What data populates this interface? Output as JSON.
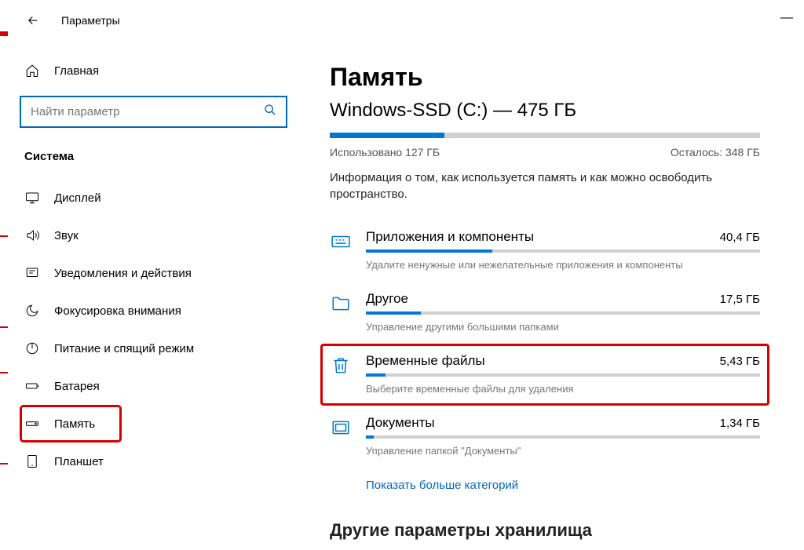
{
  "header": {
    "title": "Параметры"
  },
  "sidebar": {
    "home_label": "Главная",
    "search_placeholder": "Найти параметр",
    "section_label": "Система",
    "items": [
      {
        "label": "Дисплей",
        "icon": "display",
        "highlighted": false
      },
      {
        "label": "Звук",
        "icon": "sound",
        "highlighted": false
      },
      {
        "label": "Уведомления и действия",
        "icon": "notifications",
        "highlighted": false
      },
      {
        "label": "Фокусировка внимания",
        "icon": "focus",
        "highlighted": false
      },
      {
        "label": "Питание и спящий режим",
        "icon": "power",
        "highlighted": false
      },
      {
        "label": "Батарея",
        "icon": "battery",
        "highlighted": false
      },
      {
        "label": "Память",
        "icon": "storage",
        "highlighted": true
      },
      {
        "label": "Планшет",
        "icon": "tablet",
        "highlighted": false
      }
    ]
  },
  "main": {
    "title": "Память",
    "drive_label": "Windows-SSD (C:) — 475 ГБ",
    "used_label": "Использовано 127 ГБ",
    "remaining_label": "Осталось: 348 ГБ",
    "used_pct": 26.7,
    "description": "Информация о том, как используется память и как можно освободить пространство.",
    "categories": [
      {
        "title": "Приложения и компоненты",
        "size": "40,4 ГБ",
        "sub": "Удалите ненужные или нежелательные приложения и компоненты",
        "pct": 32,
        "icon": "apps",
        "highlighted": false
      },
      {
        "title": "Другое",
        "size": "17,5 ГБ",
        "sub": "Управление другими большими папками",
        "pct": 14,
        "icon": "folder",
        "highlighted": false
      },
      {
        "title": "Временные файлы",
        "size": "5,43 ГБ",
        "sub": "Выберите временные файлы для удаления",
        "pct": 5,
        "icon": "trash",
        "highlighted": true
      },
      {
        "title": "Документы",
        "size": "1,34 ГБ",
        "sub": "Управление папкой \"Документы\"",
        "pct": 2,
        "icon": "documents",
        "highlighted": false
      }
    ],
    "more_link": "Показать больше категорий",
    "cut_heading": "Другие параметры хранилища"
  },
  "colors": {
    "accent": "#0078d4",
    "highlight": "#d40000"
  }
}
